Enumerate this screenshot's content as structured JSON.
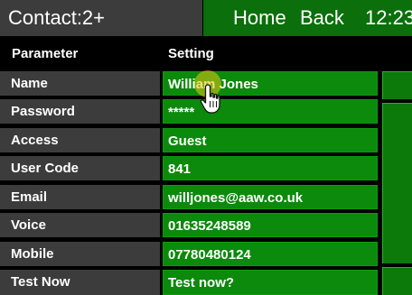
{
  "header": {
    "title": "Contact:2+",
    "home_label": "Home",
    "back_label": "Back",
    "time": "12:23"
  },
  "table": {
    "columns": [
      "Parameter",
      "Setting"
    ],
    "rows": [
      {
        "label": "Name",
        "value": "William Jones"
      },
      {
        "label": "Password",
        "value": "*****"
      },
      {
        "label": "Access",
        "value": "Guest"
      },
      {
        "label": "User Code",
        "value": "841"
      },
      {
        "label": "Email",
        "value": "willjones@aaw.co.uk"
      },
      {
        "label": "Voice",
        "value": "01635248589"
      },
      {
        "label": "Mobile",
        "value": "07780480124"
      },
      {
        "label": "Test Now",
        "value": "Test now?"
      }
    ]
  },
  "colors": {
    "accent_green": "#0b8a0b",
    "header_green": "#0b6f0b",
    "label_gray": "#3c3c3c"
  },
  "icons": [
    "hand-pointer-icon"
  ]
}
